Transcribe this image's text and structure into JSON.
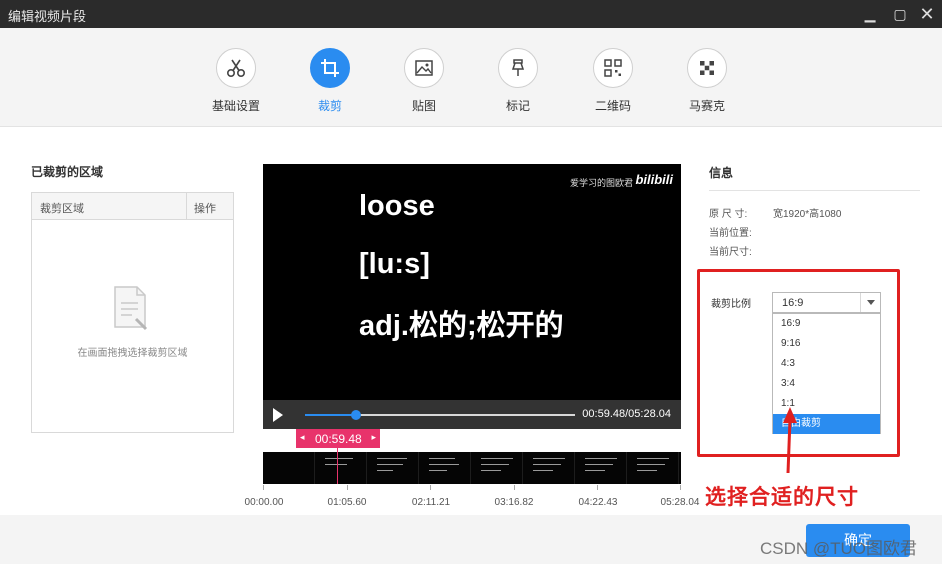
{
  "window": {
    "title": "编辑视频片段",
    "minimize_glyph": "▁",
    "maximize_glyph": "▢",
    "close_glyph": "✕"
  },
  "toolbar": {
    "tools": [
      {
        "label": "基础设置",
        "icon": "scissors-icon"
      },
      {
        "label": "裁剪",
        "icon": "crop-icon",
        "active": true
      },
      {
        "label": "贴图",
        "icon": "image-icon"
      },
      {
        "label": "标记",
        "icon": "pin-icon"
      },
      {
        "label": "二维码",
        "icon": "qr-code-icon"
      },
      {
        "label": "马赛克",
        "icon": "mosaic-icon"
      }
    ]
  },
  "crop_list": {
    "title": "已裁剪的区域",
    "col_region": "裁剪区域",
    "col_action": "操作",
    "empty_text": "在画面拖拽选择裁剪区域"
  },
  "video": {
    "watermark_text": "爱学习的图欧君",
    "watermark_logo": "bilibili",
    "lines": [
      "loose",
      "[lu:s]",
      "adj.松的;松开的"
    ],
    "time_display": "00:59.48/05:28.04",
    "progress_fraction": 0.19
  },
  "timeline": {
    "marker_time": "00:59.48",
    "marker_left": "◂",
    "marker_right": "▸",
    "labels": [
      "00:00.00",
      "01:05.60",
      "02:11.21",
      "03:16.82",
      "04:22.43",
      "05:28.04"
    ]
  },
  "info": {
    "title": "信息",
    "original_size_label": "原 尺 寸:",
    "original_size_value": "宽1920*高1080",
    "current_pos_label": "当前位置:",
    "current_size_label": "当前尺寸:",
    "ratio_label": "裁剪比例",
    "ratio_selected": "16:9",
    "ratio_options": [
      "16:9",
      "9:16",
      "4:3",
      "3:4",
      "1:1",
      "自由裁剪"
    ],
    "ratio_highlighted_index": 5
  },
  "annotation": {
    "text": "选择合适的尺寸",
    "color": "#e02020"
  },
  "footer": {
    "ok_label": "确定",
    "watermark": "CSDN @TUO图欧君"
  },
  "colors": {
    "accent": "#2a8cf0",
    "marker": "#e8336b"
  }
}
